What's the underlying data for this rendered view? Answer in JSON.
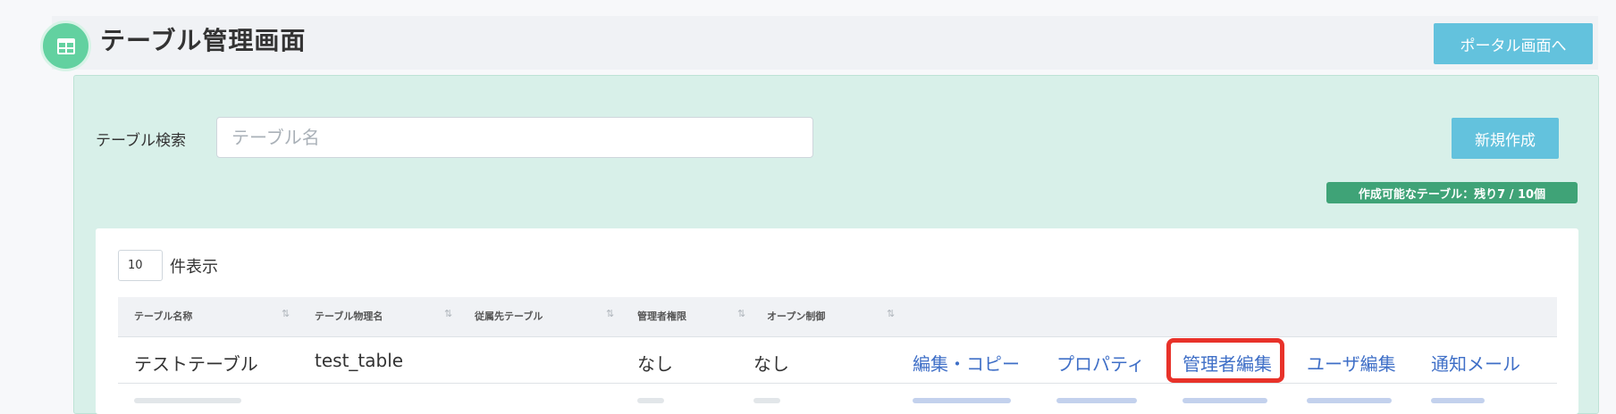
{
  "header": {
    "title": "テーブル管理画面",
    "portal_button": "ポータル画面へ",
    "icon": "table-grid-icon"
  },
  "search": {
    "label": "テーブル検索",
    "placeholder": "テーブル名",
    "value": ""
  },
  "actions": {
    "new_button": "新規作成",
    "quota_badge": "作成可能なテーブル：残り7 / 10個"
  },
  "table": {
    "page_length": "10",
    "page_length_label": "件表示",
    "columns": [
      "テーブル名称",
      "テーブル物理名",
      "従属先テーブル",
      "管理者権限",
      "オープン制御"
    ],
    "sort_glyph": "⇅",
    "rows": [
      {
        "name": "テストテーブル",
        "physical_name": "test_table",
        "parent": "",
        "admin_auth": "なし",
        "open_control": "なし",
        "links": [
          "編集・コピー",
          "プロパティ",
          "管理者編集",
          "ユーザ編集",
          "通知メール"
        ]
      }
    ]
  },
  "colors": {
    "accent": "#63c2dd",
    "panel": "#d8f0e9",
    "badge": "#3fa377",
    "link": "#3f6fc7",
    "highlight": "#e8322a"
  }
}
